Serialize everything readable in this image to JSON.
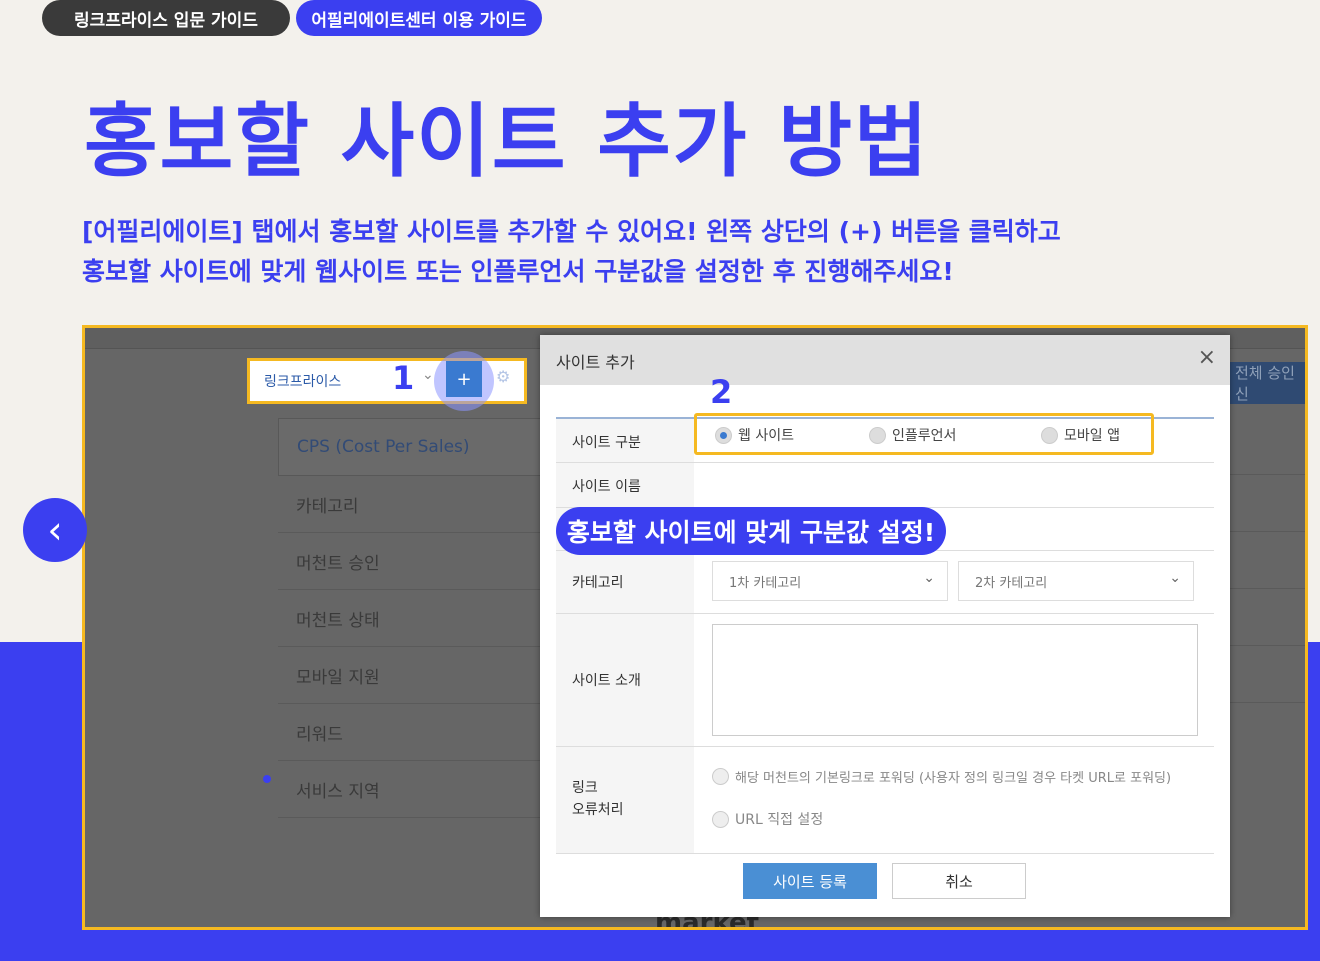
{
  "tabs": [
    {
      "label": "링크프라이스 입문 가이드",
      "active": false
    },
    {
      "label": "어필리에이트센터 이용 가이드",
      "active": true
    }
  ],
  "hero": {
    "title": "홍보할 사이트 추가 방법",
    "desc_line1": "[어필리에이트] 탭에서 홍보할 사이트를 추가할 수 있어요! 왼쪽 상단의 (+) 버튼을 클릭하고",
    "desc_line2": "홍보할 사이트에 맞게 웹사이트 또는 인플루언서 구분값을 설정한 후 진행해주세요!"
  },
  "screenshot": {
    "brand_label": "링크프라이스",
    "step1": "1",
    "step2": "2",
    "plus": "+",
    "right_button": "전체 승인 신",
    "menu": [
      "CPS (Cost Per Sales)",
      "카테고리",
      "머천트 승인",
      "머천트 상태",
      "모바일 지원",
      "리워드",
      "서비스 지역"
    ],
    "market_logo": "market",
    "modal": {
      "title": "사이트 추가",
      "close": "×",
      "labels": {
        "site_type": "사이트 구분",
        "site_name": "사이트 이름",
        "category": "카테고리",
        "intro": "사이트 소개",
        "link_error_1": "링크",
        "link_error_2": "오류처리"
      },
      "site_types": [
        "웹 사이트",
        "인플루언서",
        "모바일 앱"
      ],
      "selected_site_type": "웹 사이트",
      "category1_placeholder": "1차 카테고리",
      "category2_placeholder": "2차 카테고리",
      "link_options": [
        "해당 머천트의 기본링크로 포워딩 (사용자 정의 링크일 경우 타켓 URL로 포워딩)",
        "URL 직접 설정"
      ],
      "register_button": "사이트 등록",
      "cancel_button": "취소"
    },
    "callout": "홍보할 사이트에 맞게 구분값 설정!"
  },
  "nav": {
    "prev_symbol": "‹"
  },
  "colors": {
    "accent": "#3b3ff0",
    "highlight": "#f5b921",
    "background": "#f3f1ec"
  }
}
